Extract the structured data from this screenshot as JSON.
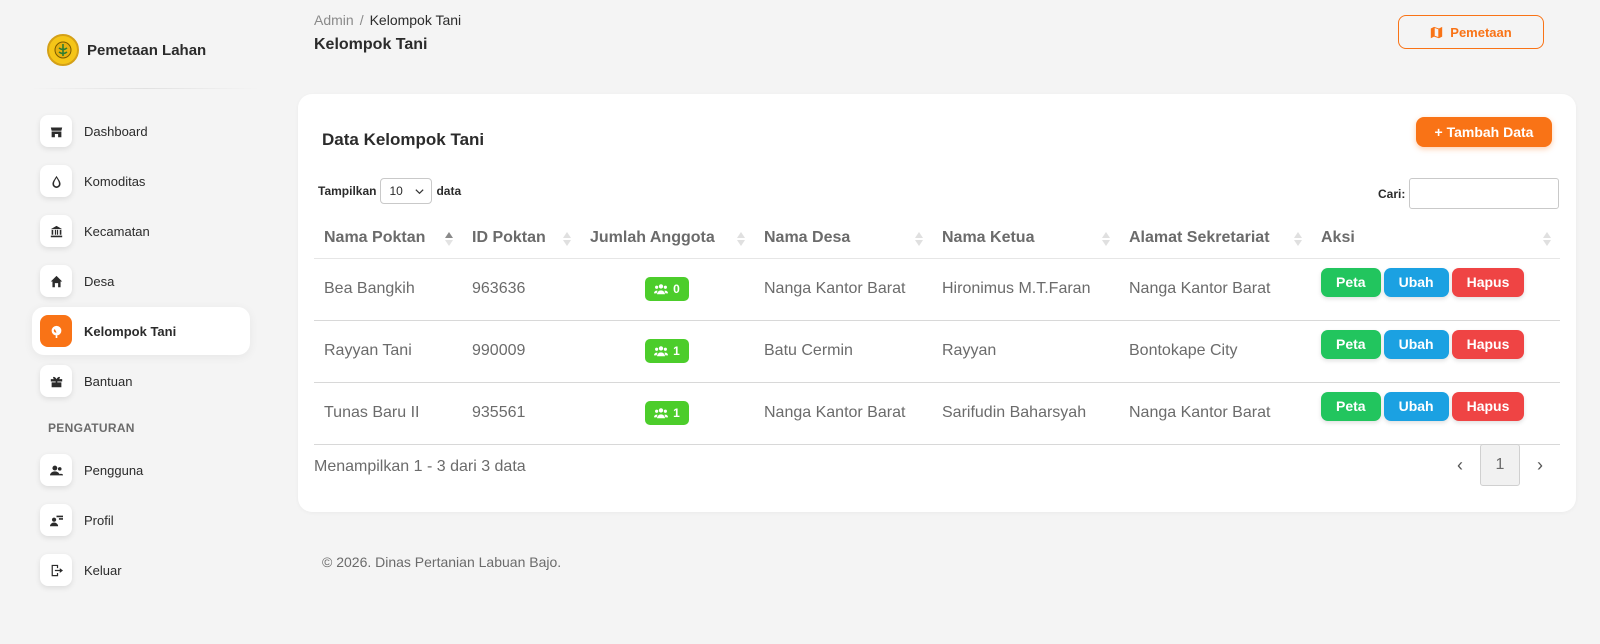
{
  "brand": {
    "name": "Pemetaan Lahan"
  },
  "sidebar": {
    "items": [
      {
        "label": "Dashboard",
        "icon": "store-icon"
      },
      {
        "label": "Komoditas",
        "icon": "droplet-icon"
      },
      {
        "label": "Kecamatan",
        "icon": "bank-icon"
      },
      {
        "label": "Desa",
        "icon": "home-icon"
      },
      {
        "label": "Kelompok Tani",
        "icon": "leaf-icon",
        "active": true
      },
      {
        "label": "Bantuan",
        "icon": "gift-icon"
      }
    ],
    "section_label": "PENGATURAN",
    "settings_items": [
      {
        "label": "Pengguna",
        "icon": "users-icon"
      },
      {
        "label": "Profil",
        "icon": "profile-icon"
      },
      {
        "label": "Keluar",
        "icon": "logout-icon"
      }
    ]
  },
  "header": {
    "breadcrumb_root": "Admin",
    "breadcrumb_separator": "/",
    "breadcrumb_current": "Kelompok Tani",
    "title": "Kelompok Tani",
    "pemetaan_label": "Pemetaan"
  },
  "card": {
    "title": "Data Kelompok Tani",
    "add_label": "+ Tambah Data",
    "show_prefix": "Tampilkan",
    "show_value": "10",
    "show_suffix": "data",
    "search_label": "Cari:",
    "search_value": ""
  },
  "table": {
    "columns": [
      "Nama Poktan",
      "ID Poktan",
      "Jumlah Anggota",
      "Nama Desa",
      "Nama Ketua",
      "Alamat Sekretariat",
      "Aksi"
    ],
    "rows": [
      {
        "nama": "Bea Bangkih",
        "id": "963636",
        "anggota": "0",
        "desa": "Nanga Kantor Barat",
        "ketua": "Hironimus M.T.Faran",
        "alamat": "Nanga Kantor Barat"
      },
      {
        "nama": "Rayyan Tani",
        "id": "990009",
        "anggota": "1",
        "desa": "Batu Cermin",
        "ketua": "Rayyan",
        "alamat": "Bontokape City"
      },
      {
        "nama": "Tunas Baru II",
        "id": "935561",
        "anggota": "1",
        "desa": "Nanga Kantor Barat",
        "ketua": "Sarifudin Baharsyah",
        "alamat": "Nanga Kantor Barat"
      }
    ],
    "actions": {
      "peta": "Peta",
      "ubah": "Ubah",
      "hapus": "Hapus"
    }
  },
  "pagination": {
    "info": "Menampilkan 1 - 3 dari 3 data",
    "prev": "‹",
    "current_page": "1",
    "next": "›"
  },
  "footer": {
    "text": "© 2026. Dinas Pertanian Labuan Bajo."
  },
  "colors": {
    "accent": "#f97316",
    "success": "#22c55e",
    "info": "#1ba1e2",
    "danger": "#ef4444",
    "badge": "#4ccd2b"
  }
}
